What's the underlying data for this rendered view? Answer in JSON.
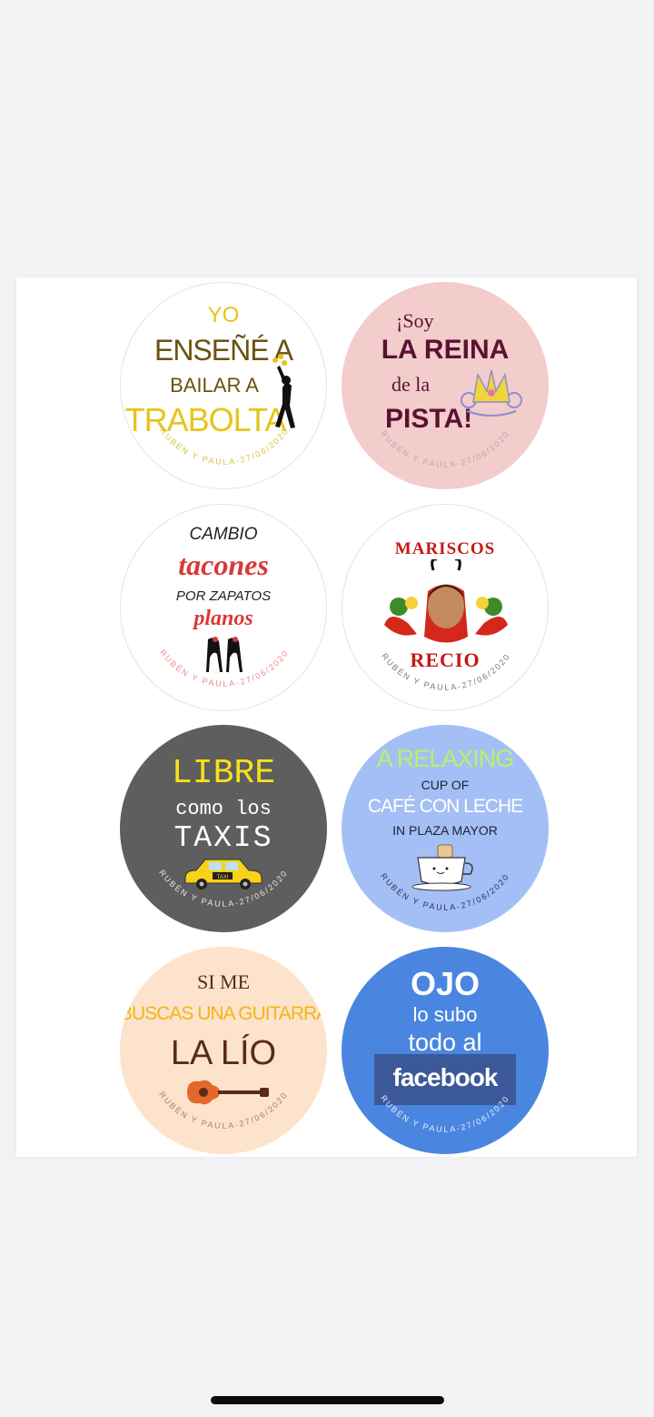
{
  "signature": "RUBÉN Y PAULA-27/06/2020",
  "badges": [
    {
      "lines": [
        "YO",
        "ENSEÑÉ A",
        "BAILAR A",
        "TRABOLTA"
      ],
      "colors": {
        "bg": "#ffffff",
        "yo": "#e8c21a",
        "main": "#6b5210",
        "trabolta": "#e6c51a",
        "arc": "#d8c23a"
      },
      "icon": "dancer-icon"
    },
    {
      "lines": [
        "¡Soy",
        "LA REINA",
        "de la",
        "PISTA!"
      ],
      "colors": {
        "bg": "#f3cccc",
        "text": "#5a1230",
        "arc": "#c9a0a8"
      },
      "icon": "crown-icon"
    },
    {
      "lines": [
        "CAMBIO",
        "tacones",
        "POR ZAPATOS",
        "planos"
      ],
      "colors": {
        "bg": "#ffffff",
        "dark": "#222222",
        "red": "#d93838",
        "arc": "#e68a8a"
      },
      "icon": "high-heels-icon"
    },
    {
      "lines": [
        "MARISCOS",
        "RECIO"
      ],
      "colors": {
        "bg": "#ffffff",
        "text": "#c41818",
        "arc": "#777777"
      },
      "icon": "lobster-face-icon"
    },
    {
      "lines": [
        "LIBRE",
        "como los",
        "TAXIS"
      ],
      "colors": {
        "bg": "#5e5e5e",
        "yellow": "#f6e01a",
        "white": "#ffffff",
        "arc": "#e6e6e6"
      },
      "icon": "taxi-icon",
      "taxi_label": "TAXI"
    },
    {
      "lines": [
        "A RELAXING",
        "CUP OF",
        "CAFÉ CON LECHE",
        "IN PLAZA MAYOR"
      ],
      "colors": {
        "bg": "#a4bff5",
        "green": "#b6f26a",
        "dark": "#1b2235",
        "white": "#ffffff",
        "arc": "#2a3350"
      },
      "icon": "coffee-cup-icon"
    },
    {
      "lines": [
        "SI ME",
        "BUSCAS UNA GUITARRA",
        "LA LÍO"
      ],
      "colors": {
        "bg": "#fde3cb",
        "dark": "#5a2a1a",
        "yellow": "#f2b516",
        "guitar": "#e2692a",
        "arc": "#a08070"
      },
      "icon": "guitar-icon"
    },
    {
      "lines": [
        "OJO",
        "lo subo",
        "todo al",
        "facebook"
      ],
      "colors": {
        "bg": "#4a86df",
        "white": "#ffffff",
        "fb": "#3b5898",
        "arc": "#e6eefc"
      },
      "icon": "facebook-logo"
    }
  ]
}
